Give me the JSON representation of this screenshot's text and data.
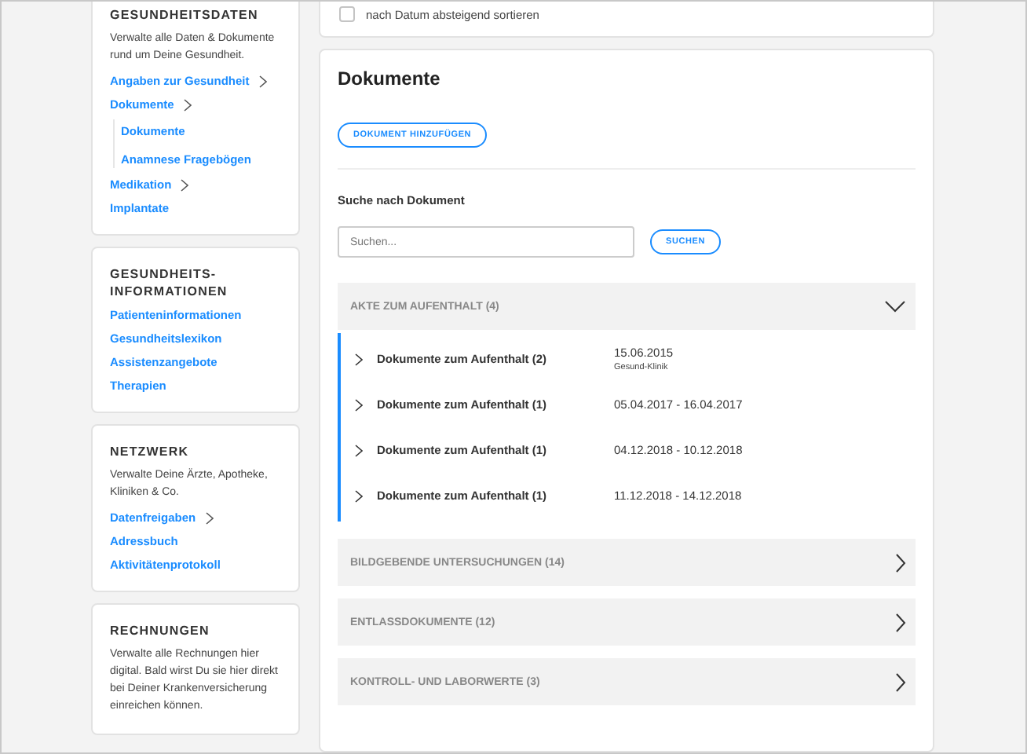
{
  "sidebar": {
    "sections": [
      {
        "title": "GESUNDHEITSDATEN",
        "description": "Verwalte alle Daten & Dokumente rund um Deine Gesundheit.",
        "links": [
          {
            "label": "Angaben zur Gesundheit",
            "expandable": true
          },
          {
            "label": "Dokumente",
            "expandable": true,
            "children": [
              {
                "label": "Dokumente"
              },
              {
                "label": "Anamnese Fragebögen"
              }
            ]
          },
          {
            "label": "Medikation",
            "expandable": true
          },
          {
            "label": "Implantate",
            "expandable": false
          }
        ]
      },
      {
        "title": "GESUNDHEITS-INFORMATIONEN",
        "links": [
          {
            "label": "Patienteninformationen",
            "expandable": false
          },
          {
            "label": "Gesundheitslexikon",
            "expandable": false
          },
          {
            "label": "Assistenzangebote",
            "expandable": false
          },
          {
            "label": "Therapien",
            "expandable": false
          }
        ]
      },
      {
        "title": "NETZWERK",
        "description": "Verwalte Deine Ärzte, Apotheke, Kliniken & Co.",
        "links": [
          {
            "label": "Datenfreigaben",
            "expandable": true
          },
          {
            "label": "Adressbuch",
            "expandable": false
          },
          {
            "label": "Aktivitätenprotokoll",
            "expandable": false
          }
        ]
      },
      {
        "title": "RECHNUNGEN",
        "description": "Verwalte alle Rechnungen hier digital. Bald wirst Du sie hier direkt bei Deiner Krankenversicherung einreichen können."
      }
    ]
  },
  "sort_option": {
    "label": "nach Datum absteigend sortieren",
    "checked": false
  },
  "documents": {
    "title": "Dokumente",
    "add_button": "DOKUMENT HINZUFÜGEN",
    "search_label": "Suche nach Dokument",
    "search": {
      "placeholder": "Suchen..."
    },
    "search_button": "SUCHEN",
    "groups": [
      {
        "title": "AKTE ZUM AUFENTHALT (4)",
        "expanded": true,
        "items": [
          {
            "title": "Dokumente zum Aufenthalt (2)",
            "date": "15.06.2015",
            "place": "Gesund-Klinik"
          },
          {
            "title": "Dokumente zum Aufenthalt (1)",
            "date": "05.04.2017 - 16.04.2017"
          },
          {
            "title": "Dokumente zum Aufenthalt (1)",
            "date": "04.12.2018 - 10.12.2018"
          },
          {
            "title": "Dokumente zum Aufenthalt (1)",
            "date": "11.12.2018 - 14.12.2018"
          }
        ]
      },
      {
        "title": "BILDGEBENDE UNTERSUCHUNGEN (14)",
        "expanded": false
      },
      {
        "title": "ENTLASSDOKUMENTE (12)",
        "expanded": false
      },
      {
        "title": "KONTROLL- UND LABORWERTE (3)",
        "expanded": false
      }
    ]
  }
}
